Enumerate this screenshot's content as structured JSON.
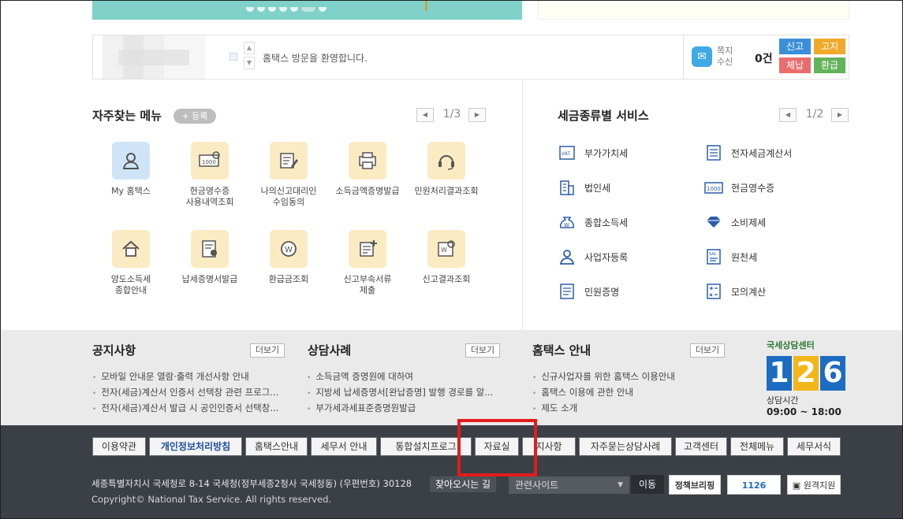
{
  "welcome": {
    "message": "홈택스 방문을 환영합니다.",
    "note_label": "쪽지\n수신",
    "note_count": "0건",
    "quick": [
      "신고",
      "고지",
      "체납",
      "환급"
    ]
  },
  "favorites": {
    "title": "자주찾는 메뉴",
    "register_label": "+ 등록",
    "page": "1/3",
    "items": [
      {
        "label": "My 홈택스",
        "icon": "user-icon"
      },
      {
        "label": "현금영수증\n사용내역조회",
        "icon": "receipt-icon"
      },
      {
        "label": "나의신고대리인\n수임동의",
        "icon": "edit-doc-icon"
      },
      {
        "label": "소득금액증명발급",
        "icon": "printer-icon"
      },
      {
        "label": "민원처리결과조회",
        "icon": "headset-icon"
      },
      {
        "label": "양도소득세\n종합안내",
        "icon": "house-icon"
      },
      {
        "label": "납세증명서발급",
        "icon": "certificate-icon"
      },
      {
        "label": "환급금조회",
        "icon": "refund-icon"
      },
      {
        "label": "신고부속서류\n제출",
        "icon": "doc-plus-icon"
      },
      {
        "label": "신고결과조회",
        "icon": "search-doc-icon"
      }
    ]
  },
  "tax_services": {
    "title": "세금종류별 서비스",
    "page": "1/2",
    "items": [
      {
        "label": "부가가치세",
        "icon": "vat-icon"
      },
      {
        "label": "전자세금계산서",
        "icon": "calculator-icon"
      },
      {
        "label": "법인세",
        "icon": "building-icon"
      },
      {
        "label": "현금영수증",
        "icon": "cash-receipt-icon"
      },
      {
        "label": "종합소득세",
        "icon": "money-bag-icon"
      },
      {
        "label": "소비제세",
        "icon": "diamond-icon"
      },
      {
        "label": "사업자등록",
        "icon": "person-icon"
      },
      {
        "label": "원천세",
        "icon": "salary-doc-icon"
      },
      {
        "label": "민원증명",
        "icon": "document-icon"
      },
      {
        "label": "모의계산",
        "icon": "calc-icon"
      }
    ]
  },
  "news": {
    "more_label": "더보기",
    "notice": {
      "title": "공지사항",
      "items": [
        "모바일 안내문 열람·출력 개선사항 안내",
        "전자(세금)계산서 인증서 선택창 관련 프로그...",
        "전자(세금)계산서 발급 시 공인인증서 선택창..."
      ]
    },
    "cases": {
      "title": "상담사례",
      "items": [
        "소득금액 증명원에 대하여",
        "지방세 납세증명서[완납증명] 발행 경로를 알...",
        "부가세과세표준증명원발급"
      ]
    },
    "guide": {
      "title": "홈택스 안내",
      "items": [
        "신규사업자를 위한 홈택스 이용안내",
        "홈택스 이용에 관한 안내",
        "제도 소개"
      ]
    }
  },
  "center": {
    "title": "국세상담센터",
    "digits": [
      "1",
      "2",
      "6"
    ],
    "hours_label": "상담시간",
    "hours": "09:00 ~ 18:00"
  },
  "footer": {
    "nav": [
      "이용약관",
      "개인정보처리방침",
      "홈택스안내",
      "세무서 안내",
      "통합설치프로그",
      "자료실",
      "지사항",
      "자주묻는상담사례",
      "고객센터",
      "전체메뉴",
      "세무서식"
    ],
    "address": "세종특별자치시 국세청로 8-14 국세청(정부세종2청사 국세청동) (우편번호) 30128",
    "find_label": "찾아오시는 길",
    "related_label": "관련사이트",
    "move_label": "이동",
    "copyright": "Copyright© National Tax Service. All rights reserved.",
    "badges": [
      "정책브리핑",
      "1126",
      "원격지원"
    ]
  },
  "colors": {
    "accent_red": "#e21b1b",
    "footer_bg": "#3b3f46",
    "teal_banner": "#7fd1c9"
  }
}
